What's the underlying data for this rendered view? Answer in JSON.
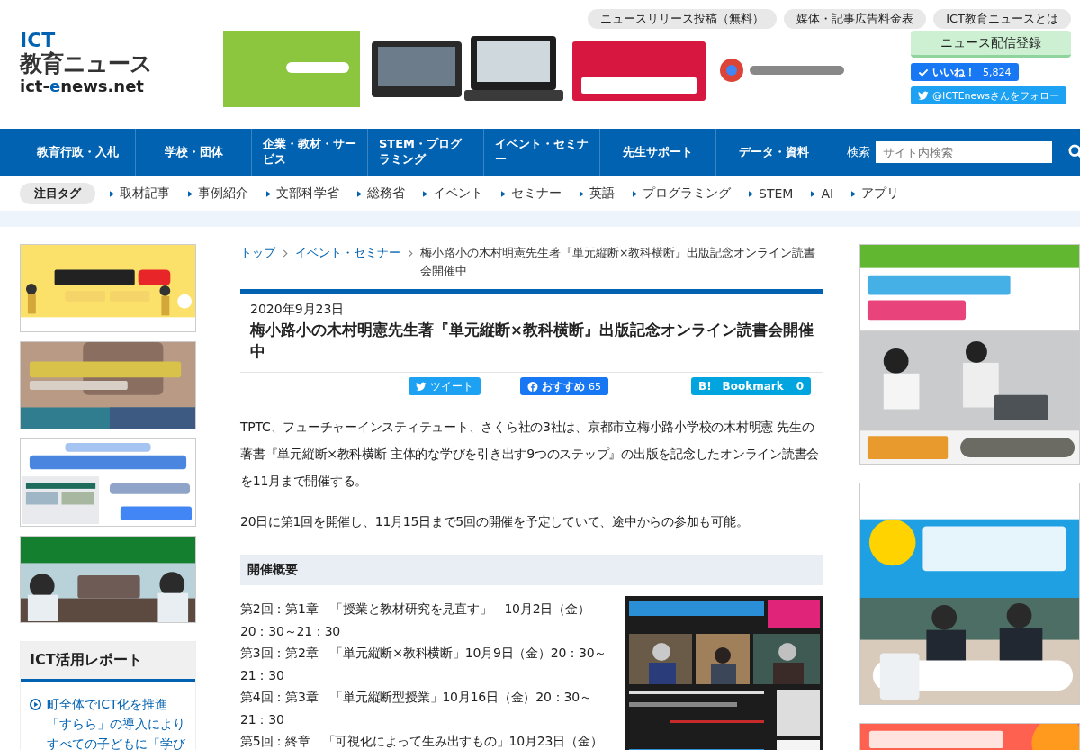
{
  "top_links": [
    "ニュースリリース投稿（無料）",
    "媒体・記事広告料金表",
    "ICT教育ニュースとは"
  ],
  "logo": {
    "line1": "ICT",
    "line2": "教育ニュース",
    "domain_parts": [
      {
        "text": "ict-",
        "accent": false
      },
      {
        "text": "e",
        "accent": true
      },
      {
        "text": "news.net",
        "accent": false
      }
    ]
  },
  "subscribe_button": "ニュース配信登録",
  "like_button": {
    "label": "いいね！",
    "count": "5,824"
  },
  "follow_button": "@ICTEnewsさんをフォロー",
  "nav": [
    "教育行政・入札",
    "学校・団体",
    "企業・教材・サービス",
    "STEM・プログラミング",
    "イベント・セミナー",
    "先生サポート",
    "データ・資料"
  ],
  "search": {
    "label": "検索",
    "placeholder": "サイト内検索"
  },
  "tags": {
    "title": "注目タグ",
    "items": [
      "取材記事",
      "事例紹介",
      "文部科学省",
      "総務省",
      "イベント",
      "セミナー",
      "英語",
      "プログラミング",
      "STEM",
      "AI",
      "アプリ"
    ]
  },
  "breadcrumb": [
    {
      "text": "トップ",
      "link": true
    },
    {
      "text": "イベント・セミナー",
      "link": true
    },
    {
      "text": "梅小路小の木村明憲先生著『単元縦断×教科横断』出版記念オンライン読書会開催中",
      "link": false
    }
  ],
  "article": {
    "date": "2020年9月23日",
    "title": "梅小路小の木村明憲先生著『単元縦断×教科横断』出版記念オンライン読書会開催中",
    "share": {
      "tweet": "ツイート",
      "facebook": {
        "label": "おすすめ",
        "count": "65"
      },
      "hatena": {
        "mark": "B!",
        "label": "Bookmark",
        "count": "0"
      }
    },
    "paragraphs": [
      "TPTC、フューチャーインスティテュート、さくら社の3社は、京都市立梅小路小学校の木村明憲 先生の著書『単元縦断×教科横断 主体的な学びを引き出す9つのステップ』の出版を記念したオンライン読書会を11月まで開催する。",
      "20日に第1回を開催し、11月15日まで5回の開催を予定していて、途中からの参加も可能。"
    ],
    "section_heading": "開催概要",
    "schedule": [
      "第2回：第1章　「授業と教材研究を見直す」　10月2日（金）20：30～21：30",
      "第3回：第2章　「単元縦断×教科横断」10月9日（金）20：30～21：30",
      "第4回：第3章　「単元縦断型授業」10月16日（金）20：30～21：30",
      "第5回：終章　「可視化によって生み出すもの」10月23日（金）"
    ]
  },
  "report": {
    "title": "ICT活用レポート",
    "items": [
      {
        "lines": [
          "町全体でICT化を推進",
          "「すらら」の導入により",
          "すべての子どもに「学び"
        ]
      }
    ]
  }
}
